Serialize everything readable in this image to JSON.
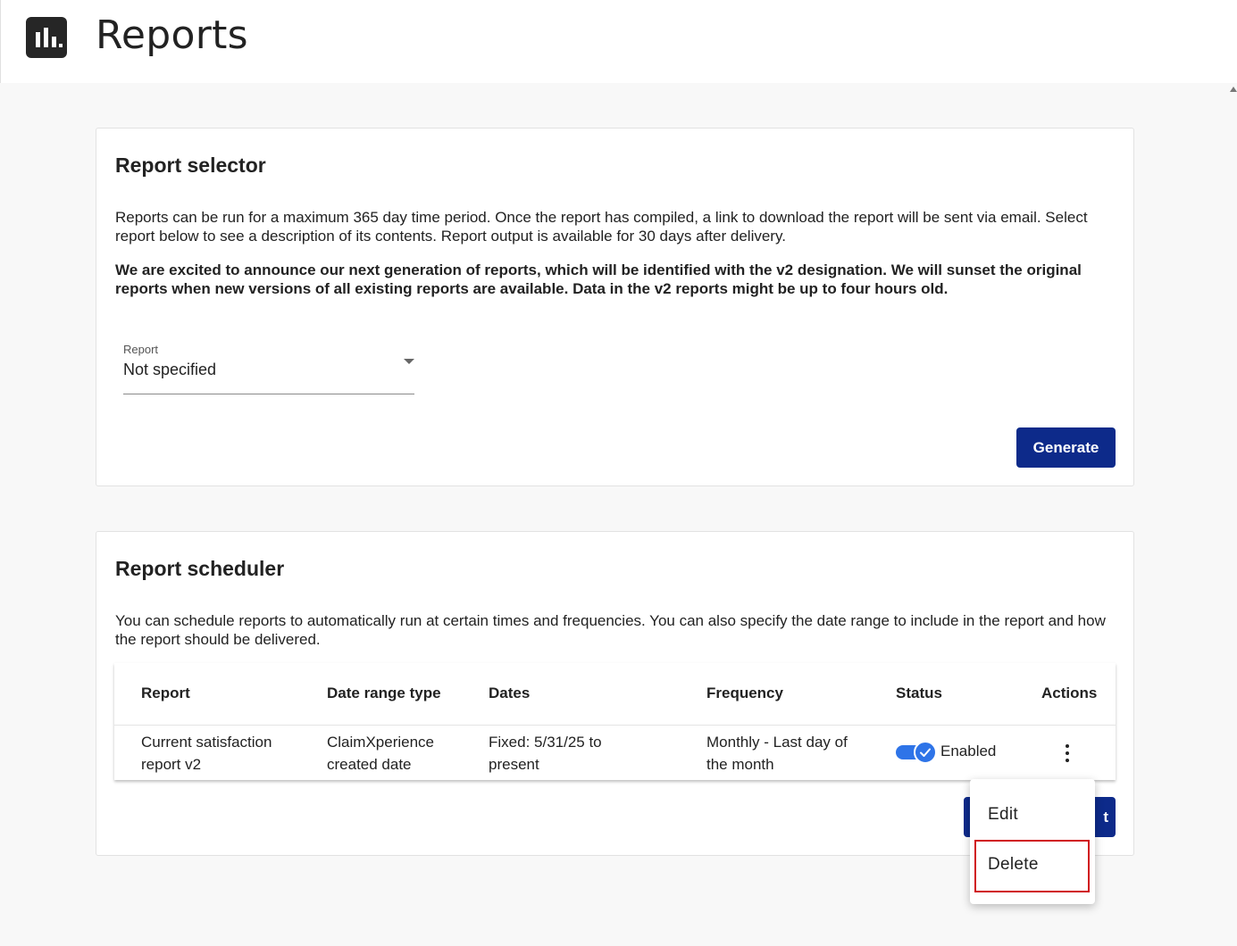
{
  "header": {
    "title": "Reports",
    "logo_icon": "bar-chart-icon"
  },
  "report_selector": {
    "title": "Report selector",
    "description": "Reports can be run for a maximum 365 day time period. Once the report has compiled, a link to download the report will be sent via email. Select report below to see a description of its contents. Report output is available for 30 days after delivery.",
    "announcement": "We are excited to announce our next generation of reports, which will be identified with the v2 designation. We will sunset the original reports when new versions of all existing reports are available. Data in the v2 reports might be up to four hours old.",
    "select": {
      "label": "Report",
      "value": "Not specified"
    },
    "generate_label": "Generate"
  },
  "report_scheduler": {
    "title": "Report scheduler",
    "description": "You can schedule reports to automatically run at certain times and frequencies. You can also specify the date range to include in the report and how the report should be delivered.",
    "columns": [
      "Report",
      "Date range type",
      "Dates",
      "Frequency",
      "Status",
      "Actions"
    ],
    "rows": [
      {
        "report": "Current satisfaction report v2",
        "date_range_type": "ClaimXperience created date",
        "dates": "Fixed: 5/31/25 to present",
        "frequency": "Monthly - Last day of the month",
        "status": "Enabled",
        "status_on": true
      }
    ],
    "hidden_button_label": "t"
  },
  "context_menu": {
    "items": [
      "Edit",
      "Delete"
    ],
    "highlighted": "Delete"
  },
  "colors": {
    "primary": "#0d2a8a",
    "toggle": "#2e74e8",
    "highlight": "#d0131b"
  }
}
